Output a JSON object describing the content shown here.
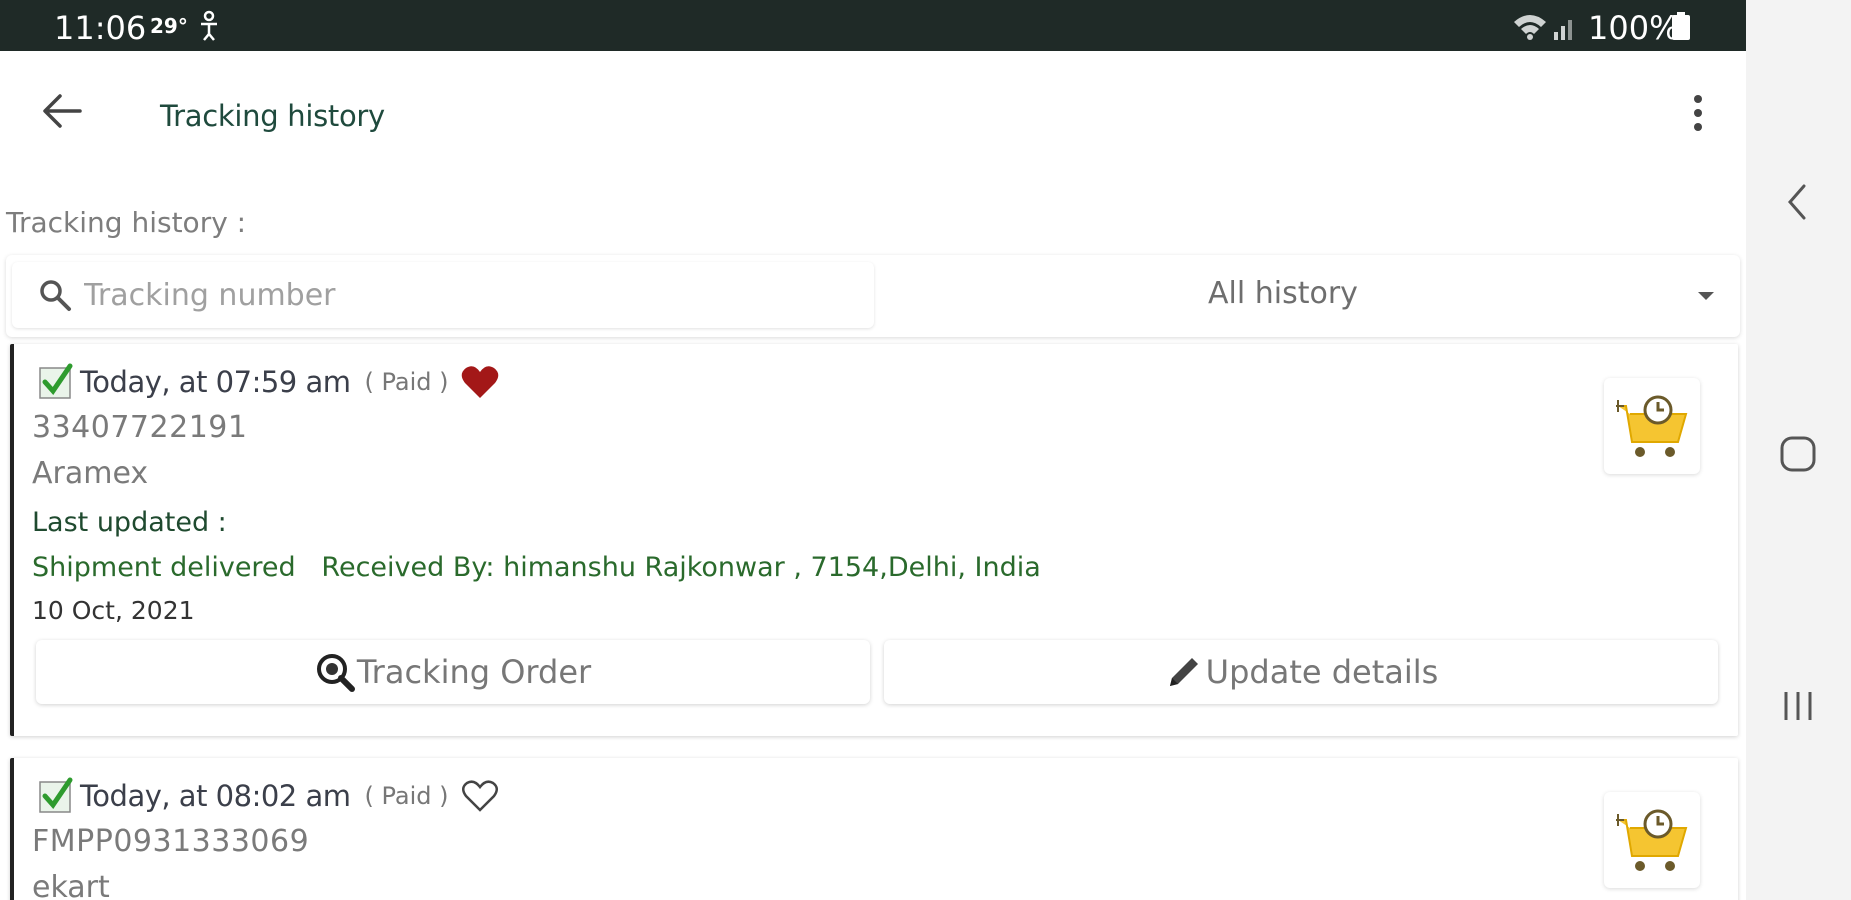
{
  "status_bar": {
    "time": "11:06",
    "temperature": "29°",
    "battery": "100%"
  },
  "app_bar": {
    "title": "Tracking history"
  },
  "section_label": "Tracking history :",
  "search": {
    "placeholder": "Tracking number",
    "value": ""
  },
  "filter": {
    "selected": "All history"
  },
  "cards": [
    {
      "time": "Today, at 07:59 am",
      "paid": "( Paid )",
      "favorite": true,
      "tracking_number": "33407722191",
      "carrier": "Aramex",
      "last_updated_label": "Last updated :",
      "status": "Shipment delivered   Received By: himanshu Rajkonwar , 7154,Delhi, India",
      "date": "10 Oct, 2021",
      "track_button": "Tracking Order",
      "update_button": "Update details"
    },
    {
      "time": "Today, at 08:02 am",
      "paid": "( Paid )",
      "favorite": false,
      "tracking_number": "FMPP0931333069",
      "carrier": "ekart"
    }
  ],
  "colors": {
    "status_bar_bg": "#1f2a27",
    "title": "#1f4a3d",
    "heart_filled": "#a31818",
    "checkbox_check": "#2e9b2e",
    "status_text": "#2a6a2c",
    "cart_yellow": "#f5c531"
  }
}
